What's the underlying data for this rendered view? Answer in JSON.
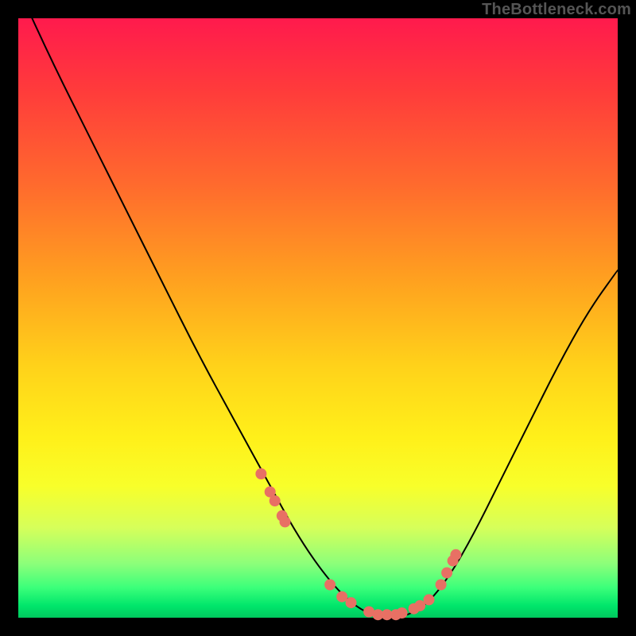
{
  "watermark": "TheBottleneck.com",
  "chart_data": {
    "type": "line",
    "title": "",
    "xlabel": "",
    "ylabel": "",
    "xlim": [
      0,
      100
    ],
    "ylim": [
      0,
      100
    ],
    "curve": {
      "name": "bottleneck-curve",
      "x": [
        0,
        6,
        12,
        18,
        24,
        30,
        36,
        42,
        47,
        52,
        56,
        60,
        64,
        68,
        72,
        76,
        80,
        85,
        90,
        95,
        100
      ],
      "y": [
        105,
        92,
        80,
        68,
        56,
        44,
        33,
        22,
        13,
        6,
        2,
        0,
        0,
        2,
        7,
        14,
        22,
        32,
        42,
        51,
        58
      ]
    },
    "marker_series": {
      "name": "highlight-dots",
      "x": [
        40.5,
        42.0,
        42.8,
        44.0,
        44.5,
        52.0,
        54.0,
        55.5,
        58.5,
        60.0,
        61.5,
        63.0,
        64.0,
        66.0,
        67.0,
        68.5,
        70.5,
        71.5,
        72.5,
        73.0
      ],
      "y": [
        24.0,
        21.0,
        19.5,
        17.0,
        16.0,
        5.5,
        3.5,
        2.5,
        1.0,
        0.5,
        0.5,
        0.5,
        0.8,
        1.5,
        2.0,
        3.0,
        5.5,
        7.5,
        9.5,
        10.5
      ]
    },
    "background_gradient": {
      "top": "#ff1a4d",
      "mid": "#ffd21a",
      "bottom": "#00c85e"
    }
  }
}
